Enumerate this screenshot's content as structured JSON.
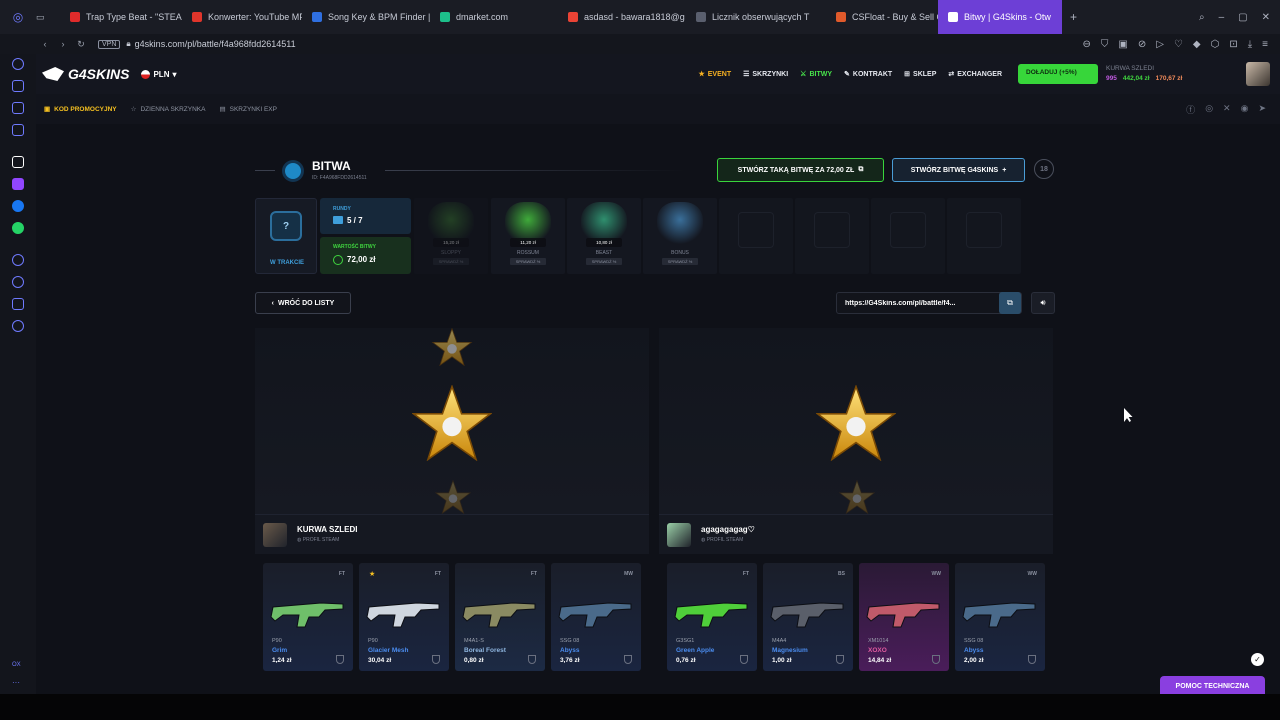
{
  "browser": {
    "tabs": [
      {
        "label": "Trap Type Beat - \"STEAD",
        "color": "#e02b2b"
      },
      {
        "label": "Konwerter: YouTube MP3",
        "color": "#e0352b"
      },
      {
        "label": "Song Key & BPM Finder |",
        "color": "#2f6fe0"
      },
      {
        "label": "dmarket.com",
        "color": "#1dbf8a"
      },
      {
        "label": "asdasd - bawara1818@g",
        "color": "#ea4335"
      },
      {
        "label": "Licznik obserwujących T",
        "color": "#5a5f6e"
      },
      {
        "label": "CSFloat - Buy & Sell CS2",
        "color": "#e05a2b"
      },
      {
        "label": "Bitwy | G4Skins - Otw",
        "color": "#ffffff"
      }
    ],
    "vpn": "VPN",
    "url": "g4skins.com/pl/battle/f4a968fdd2614511"
  },
  "header": {
    "logo": "G4SKINS",
    "currency": "PLN",
    "nav": [
      "EVENT",
      "SKRZYNKI",
      "BITWY",
      "KONTRAKT",
      "SKLEP",
      "EXCHANGER"
    ],
    "deposit": "DOŁADUJ (+5%)",
    "username": "KURWA SZLEDI",
    "level": "995",
    "balance": "442,04 zł",
    "points": "170,67 zł"
  },
  "subheader": {
    "promo": "KOD PROMOCYJNY",
    "daily": "DZIENNA SKRZYNKA",
    "exp": "SKRZYNKI EXP"
  },
  "battle": {
    "title": "BITWA",
    "id": "ID: F4A968FDD2614511",
    "copy_btn": "STWÓRZ TAKĄ BITWĘ ZA 72,00 ZŁ",
    "new_btn": "STWÓRZ BITWĘ G4SKINS",
    "age": "18",
    "status": "W TRAKCIE",
    "rounds_label": "RUNDY",
    "rounds_value": "5 / 7",
    "value_label": "WARTOŚĆ BITWY",
    "value_value": "72,00 zł",
    "cases": [
      {
        "name": "SLOPPY",
        "price": "15,20 zł",
        "check": "SPRAWDŹ %",
        "color": "#3c7a35",
        "dim": true
      },
      {
        "name": "ROSSUM",
        "price": "11,20 zł",
        "check": "SPRAWDŹ %",
        "color": "#3faa3a",
        "dim": false
      },
      {
        "name": "BEAST",
        "price": "10,80 zł",
        "check": "SPRAWDŹ %",
        "color": "#2f8f6e",
        "dim": false
      },
      {
        "name": "BONUS",
        "price": "",
        "check": "SPRAWDŹ %",
        "color": "#3a6f9a",
        "dim": false
      }
    ],
    "back": "WRÓĆ DO LISTY",
    "link": "https://G4Skins.com/pl/battle/f4..."
  },
  "players": [
    {
      "name": "KURWA SZLEDI",
      "steam": "PROFIL STEAM",
      "avatar_color": "#6a5a4a"
    },
    {
      "name": "agagagagag♡",
      "steam": "PROFIL STEAM",
      "avatar_color": "#9bd0a8"
    }
  ],
  "drops": [
    {
      "weapon": "P90",
      "skin": "Grim",
      "price": "1,24 zł",
      "cond": "FT",
      "rarity": "r-blue",
      "skin_color": "#4b8df0",
      "gun_color": "#6fbf6a",
      "fav": false
    },
    {
      "weapon": "P90",
      "skin": "Glacier Mesh",
      "price": "30,04 zł",
      "cond": "FT",
      "rarity": "r-blue",
      "skin_color": "#4b8df0",
      "gun_color": "#cfd6df",
      "fav": true
    },
    {
      "weapon": "M4A1-S",
      "skin": "Boreal Forest",
      "price": "0,80 zł",
      "cond": "FT",
      "rarity": "r-lblue",
      "skin_color": "#8fb6e0",
      "gun_color": "#8a8a62",
      "fav": false
    },
    {
      "weapon": "SSG 08",
      "skin": "Abyss",
      "price": "3,76 zł",
      "cond": "MW",
      "rarity": "r-blue",
      "skin_color": "#4b8df0",
      "gun_color": "#4a6a8a",
      "fav": false
    },
    {
      "weapon": "G3SG1",
      "skin": "Green Apple",
      "price": "0,76 zł",
      "cond": "FT",
      "rarity": "r-blue",
      "skin_color": "#4b8df0",
      "gun_color": "#4fcf3a",
      "fav": false
    },
    {
      "weapon": "M4A4",
      "skin": "Magnesium",
      "price": "1,00 zł",
      "cond": "BS",
      "rarity": "r-blue",
      "skin_color": "#4b8df0",
      "gun_color": "#5a5f6a",
      "fav": false
    },
    {
      "weapon": "XM1014",
      "skin": "XOXO",
      "price": "14,84 zł",
      "cond": "WW",
      "rarity": "r-pink",
      "skin_color": "#e05aa0",
      "gun_color": "#c05a6a",
      "fav": false
    },
    {
      "weapon": "SSG 08",
      "skin": "Abyss",
      "price": "2,00 zł",
      "cond": "WW",
      "rarity": "r-blue",
      "skin_color": "#4b8df0",
      "gun_color": "#4a6a8a",
      "fav": false
    }
  ],
  "support": "POMOC TECHNICZNA",
  "opera_side_label": "OX"
}
